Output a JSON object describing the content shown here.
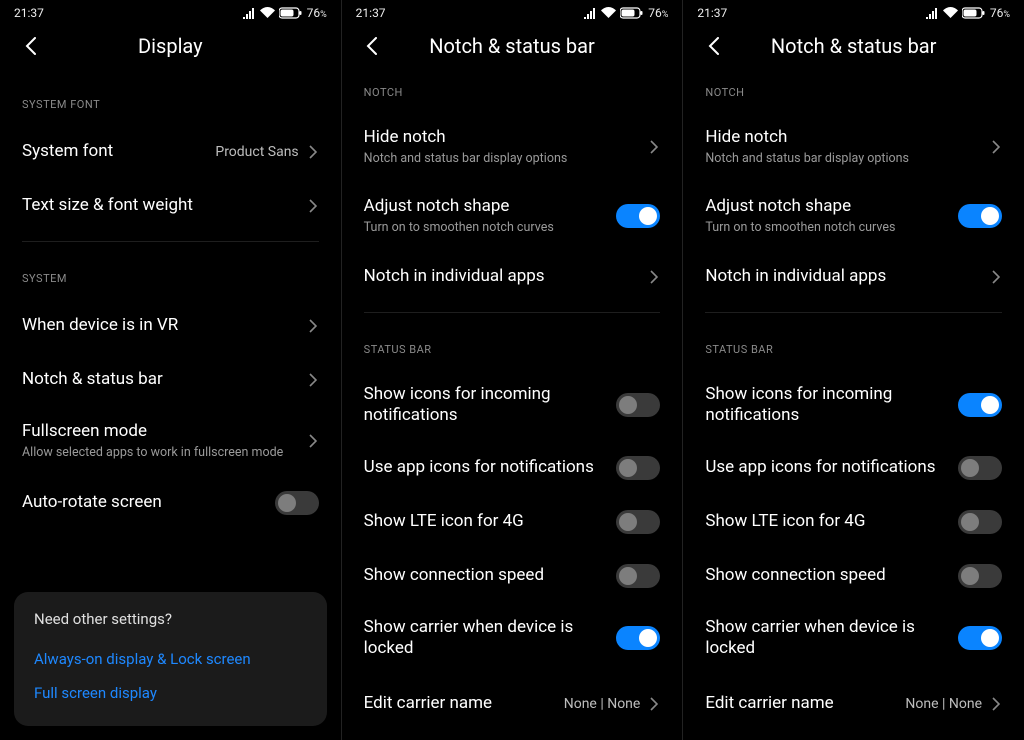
{
  "status": {
    "time": "21:37",
    "battery_pct": "76",
    "battery_unit": "%"
  },
  "s1": {
    "title": "Display",
    "sec_font": "SYSTEM FONT",
    "system_font_label": "System font",
    "system_font_value": "Product Sans",
    "text_size_label": "Text size & font weight",
    "sec_system": "SYSTEM",
    "vr_label": "When device is in VR",
    "notch_label": "Notch & status bar",
    "fullscreen_label": "Fullscreen mode",
    "fullscreen_sub": "Allow selected apps to work in fullscreen mode",
    "autorotate_label": "Auto-rotate screen",
    "autorotate_on": false,
    "card_title": "Need other settings?",
    "card_link1": "Always-on display & Lock screen",
    "card_link2": "Full screen display"
  },
  "s2": {
    "title": "Notch & status bar",
    "sec_notch": "NOTCH",
    "hide_notch": "Hide notch",
    "hide_notch_sub": "Notch and status bar display options",
    "adjust_label": "Adjust notch shape",
    "adjust_sub": "Turn on to smoothen notch curves",
    "adjust_on": true,
    "notch_apps": "Notch in individual apps",
    "sec_statusbar": "STATUS BAR",
    "show_icons": "Show icons for incoming notifications",
    "show_icons_on": false,
    "app_icons": "Use app icons for notifications",
    "app_icons_on": false,
    "lte_label": "Show LTE icon for 4G",
    "lte_on": false,
    "conn_label": "Show connection speed",
    "conn_on": false,
    "carrier_label": "Show carrier when device is locked",
    "carrier_on": true,
    "edit_carrier": "Edit carrier name",
    "edit_carrier_value": "None | None"
  },
  "s3": {
    "title": "Notch & status bar",
    "sec_notch": "NOTCH",
    "hide_notch": "Hide notch",
    "hide_notch_sub": "Notch and status bar display options",
    "adjust_label": "Adjust notch shape",
    "adjust_sub": "Turn on to smoothen notch curves",
    "adjust_on": true,
    "notch_apps": "Notch in individual apps",
    "sec_statusbar": "STATUS BAR",
    "show_icons": "Show icons for incoming notifications",
    "show_icons_on": true,
    "app_icons": "Use app icons for notifications",
    "app_icons_on": false,
    "lte_label": "Show LTE icon for 4G",
    "lte_on": false,
    "conn_label": "Show connection speed",
    "conn_on": false,
    "carrier_label": "Show carrier when device is locked",
    "carrier_on": true,
    "edit_carrier": "Edit carrier name",
    "edit_carrier_value": "None | None"
  }
}
